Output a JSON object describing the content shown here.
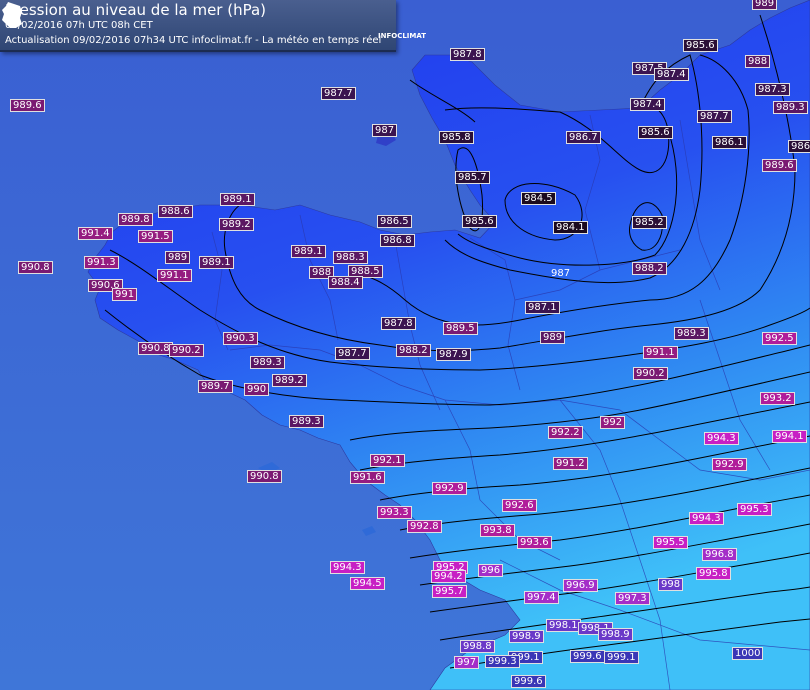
{
  "header": {
    "title": "Pression au niveau de la mer (hPa)",
    "subtitle": "09/02/2016  07h UTC  08h CET",
    "update": "Actualisation 09/02/2016 07h34 UTC   infoclimat.fr - La météo en temps réel",
    "logo_text": "INFOCLIMAT"
  },
  "colors": {
    "sea_deep": "#3a66d0",
    "land_north": "#1e3cf0",
    "land_south": "#3cb4f6",
    "label_low": "#2a1040",
    "label_mid": "#8a1b74",
    "label_high": "#d21ed2"
  },
  "isobar_label": "987",
  "stations": [
    {
      "v": "989"
    },
    {
      "v": "989.6"
    },
    {
      "v": "987.8"
    },
    {
      "v": "985.6"
    },
    {
      "v": "987.5"
    },
    {
      "v": "987.4"
    },
    {
      "v": "988"
    },
    {
      "v": "987.7"
    },
    {
      "v": "987.3"
    },
    {
      "v": "987.4"
    },
    {
      "v": "989.3"
    },
    {
      "v": "987"
    },
    {
      "v": "985.8"
    },
    {
      "v": "986.7"
    },
    {
      "v": "985.6"
    },
    {
      "v": "987.7"
    },
    {
      "v": "986.1"
    },
    {
      "v": "986"
    },
    {
      "v": "989.6"
    },
    {
      "v": "985.7"
    },
    {
      "v": "984.5"
    },
    {
      "v": "984.1"
    },
    {
      "v": "985.2"
    },
    {
      "v": "985.6"
    },
    {
      "v": "989.1"
    },
    {
      "v": "989.8"
    },
    {
      "v": "988.6"
    },
    {
      "v": "989.2"
    },
    {
      "v": "986.5"
    },
    {
      "v": "986.8"
    },
    {
      "v": "991.4"
    },
    {
      "v": "991.5"
    },
    {
      "v": "989"
    },
    {
      "v": "989.1"
    },
    {
      "v": "989.1"
    },
    {
      "v": "988.3"
    },
    {
      "v": "988"
    },
    {
      "v": "988.5"
    },
    {
      "v": "988.4"
    },
    {
      "v": "988.2"
    },
    {
      "v": "990.8"
    },
    {
      "v": "991.3"
    },
    {
      "v": "991.1"
    },
    {
      "v": "990.6"
    },
    {
      "v": "991"
    },
    {
      "v": "987.1"
    },
    {
      "v": "987.8"
    },
    {
      "v": "989.5"
    },
    {
      "v": "990.3"
    },
    {
      "v": "989.3"
    },
    {
      "v": "992.5"
    },
    {
      "v": "990.8"
    },
    {
      "v": "990.2"
    },
    {
      "v": "987.7"
    },
    {
      "v": "988.2"
    },
    {
      "v": "987.9"
    },
    {
      "v": "989"
    },
    {
      "v": "991.1"
    },
    {
      "v": "989.3"
    },
    {
      "v": "990.2"
    },
    {
      "v": "989.7"
    },
    {
      "v": "990"
    },
    {
      "v": "989.2"
    },
    {
      "v": "993.2"
    },
    {
      "v": "989.3"
    },
    {
      "v": "992"
    },
    {
      "v": "992.2"
    },
    {
      "v": "994.3"
    },
    {
      "v": "994.1"
    },
    {
      "v": "991.2"
    },
    {
      "v": "992.9"
    },
    {
      "v": "992.1"
    },
    {
      "v": "990.8"
    },
    {
      "v": "991.6"
    },
    {
      "v": "992.9"
    },
    {
      "v": "992.6"
    },
    {
      "v": "995.3"
    },
    {
      "v": "993.3"
    },
    {
      "v": "992.8"
    },
    {
      "v": "993.8"
    },
    {
      "v": "994.3"
    },
    {
      "v": "993.6"
    },
    {
      "v": "995.5"
    },
    {
      "v": "996.8"
    },
    {
      "v": "994.3"
    },
    {
      "v": "995.2"
    },
    {
      "v": "996"
    },
    {
      "v": "994.2"
    },
    {
      "v": "995.8"
    },
    {
      "v": "994.5"
    },
    {
      "v": "996.9"
    },
    {
      "v": "998"
    },
    {
      "v": "995.7"
    },
    {
      "v": "997.4"
    },
    {
      "v": "997.3"
    },
    {
      "v": "998.1"
    },
    {
      "v": "998.1"
    },
    {
      "v": "998.9"
    },
    {
      "v": "998.9"
    },
    {
      "v": "998.8"
    },
    {
      "v": "999.1"
    },
    {
      "v": "999.6"
    },
    {
      "v": "1000"
    },
    {
      "v": "997"
    },
    {
      "v": "999.3"
    },
    {
      "v": "999.1"
    },
    {
      "v": "999.6"
    }
  ]
}
